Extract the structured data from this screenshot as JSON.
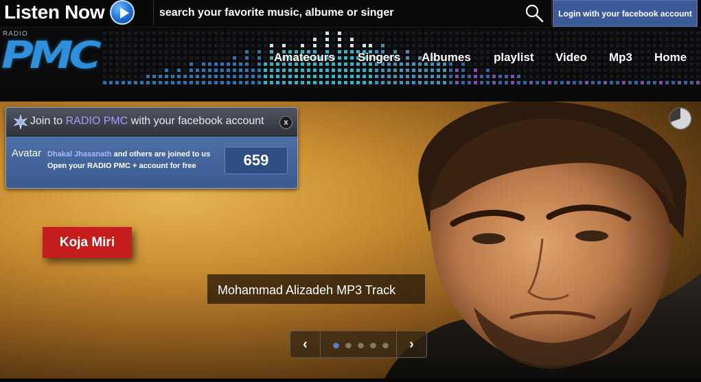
{
  "topbar": {
    "listen_now": "Listen Now",
    "search_placeholder": "search your favorite music, albume or singer",
    "fb_login": "Login with your facebook account"
  },
  "logo": {
    "radio": "RADIO",
    "pmc": "PMC"
  },
  "nav": {
    "items": [
      {
        "label": "Amateours"
      },
      {
        "label": "Singers"
      },
      {
        "label": "Albumes"
      },
      {
        "label": "playlist"
      },
      {
        "label": "Video"
      },
      {
        "label": "Mp3"
      },
      {
        "label": "Home"
      }
    ]
  },
  "join_panel": {
    "title_prefix": "Join to",
    "title_brand": "RADIO PMC",
    "title_suffix": "with your facebook account",
    "close": "x",
    "avatar_label": "Avatar",
    "joined_name": "Dhakal Jhasanath",
    "joined_text": "and others are joined to us",
    "open_text": "Open your RADIO PMC + account for free",
    "count": "659"
  },
  "slide": {
    "button": "Koja Miri",
    "caption": "Mohammad Alizadeh MP3 Track",
    "dot_count": 5,
    "active_dot": 1
  },
  "colors": {
    "fb_blue": "#3d5a98",
    "accent_red": "#c51d1d",
    "brand_purple": "#a39cff",
    "logo_blue": "#2f8fd8"
  },
  "icons": {
    "play": "play-icon",
    "search": "search-icon",
    "star": "star-icon",
    "close": "close-icon",
    "loader": "loader-icon",
    "prev": "chevron-left-icon",
    "next": "chevron-right-icon"
  }
}
